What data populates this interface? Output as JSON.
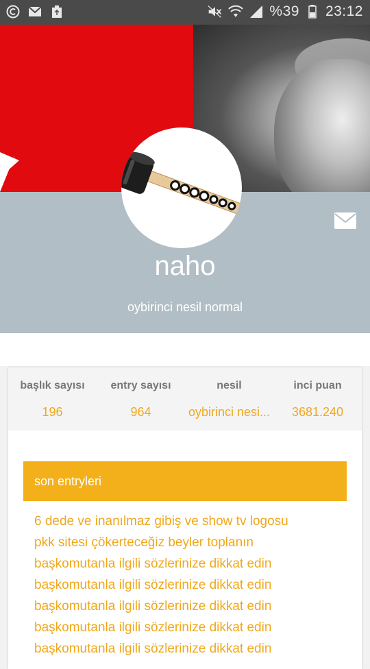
{
  "status_bar": {
    "battery_text": "%39",
    "time": "23:12",
    "icons": [
      "copyright-icon",
      "mail-icon",
      "recycle-icon",
      "mute-icon",
      "wifi-icon",
      "signal-icon",
      "battery-icon"
    ]
  },
  "profile": {
    "username": "naho",
    "tagline": "oybirinci nesil normal"
  },
  "stats": [
    {
      "label": "başlık sayısı",
      "value": "196"
    },
    {
      "label": "entry sayısı",
      "value": "964"
    },
    {
      "label": "nesil",
      "value": "oybirinci nesi..."
    },
    {
      "label": "inci puan",
      "value": "3681.240"
    }
  ],
  "section": {
    "title": "son entryleri"
  },
  "entries": [
    "6 dede ve inanılmaz gibiş ve show tv logosu",
    "pkk sitesi çökerteceğiz beyler toplanın",
    "başkomutanla ilgili sözlerinize dikkat edin",
    "başkomutanla ilgili sözlerinize dikkat edin",
    "başkomutanla ilgili sözlerinize dikkat edin",
    "başkomutanla ilgili sözlerinize dikkat edin",
    "başkomutanla ilgili sözlerinize dikkat edin"
  ],
  "colors": {
    "accent": "#f3b01b",
    "header_bg": "#b2bec5",
    "status_bar_bg": "#4a4a4a",
    "flag_red": "#e10a0f"
  }
}
